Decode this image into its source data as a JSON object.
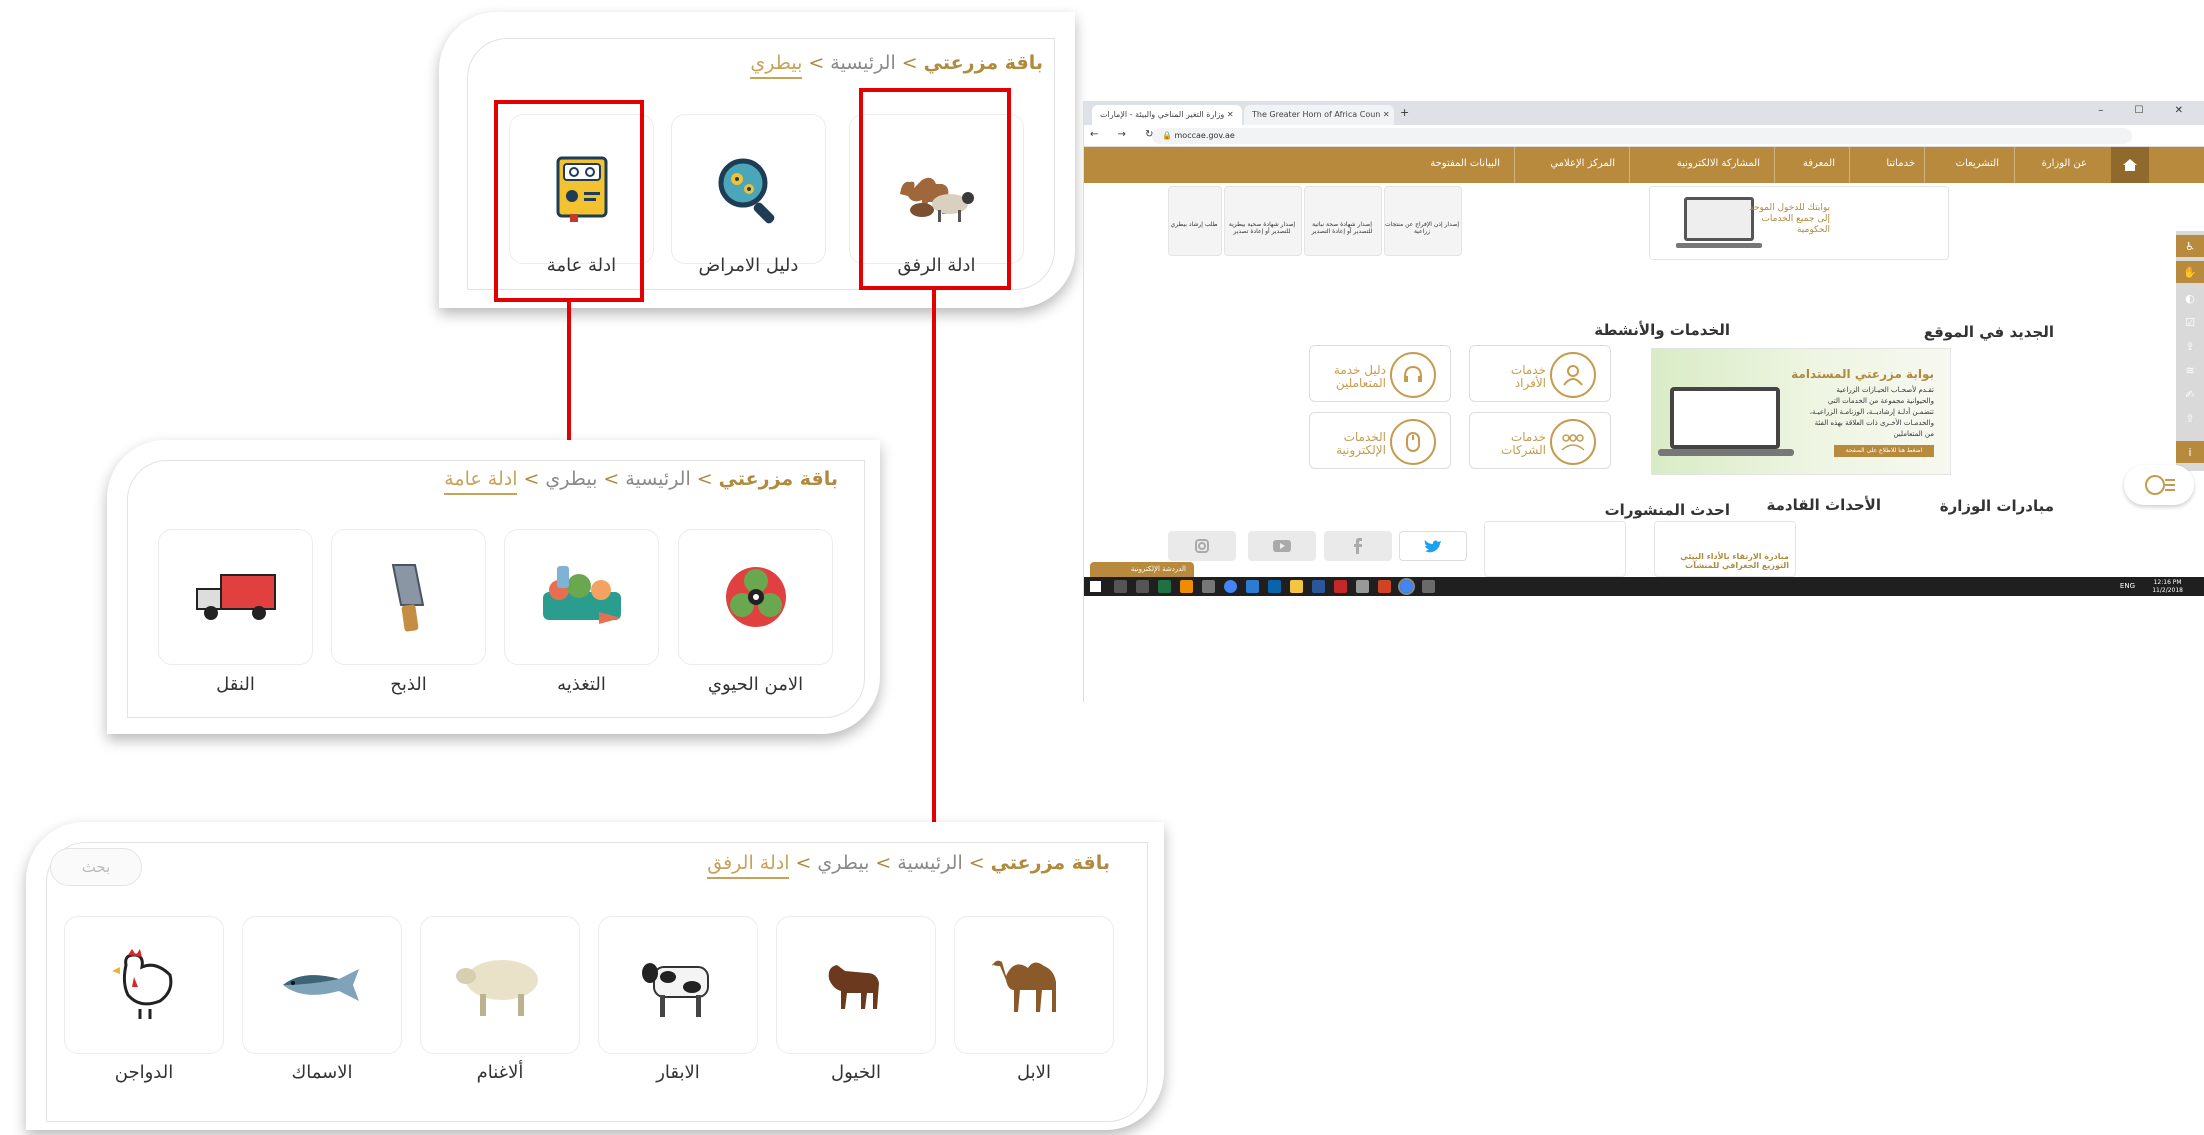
{
  "zoom_top": {
    "breadcrumb": {
      "brand": "باقة مزرعتي",
      "sep1": ">",
      "home": "الرئيسية",
      "sep2": ">",
      "current": "بيطري"
    },
    "tiles": [
      {
        "label": "ادلة الرفق",
        "icon": "camel-sheep-icon",
        "highlighted": true
      },
      {
        "label": "دليل الامراض",
        "icon": "microscope-virus-icon",
        "highlighted": false
      },
      {
        "label": "ادلة عامة",
        "icon": "guide-book-icon",
        "highlighted": true
      }
    ]
  },
  "zoom_mid": {
    "breadcrumb": {
      "brand": "باقة مزرعتي",
      "sep1": ">",
      "home": "الرئيسية",
      "sep2": ">",
      "parent": "بيطري",
      "sep3": ">",
      "current": "ادلة عامة"
    },
    "tiles": [
      {
        "label": "الامن الحيوي",
        "icon": "biohazard-icon"
      },
      {
        "label": "التغذيه",
        "icon": "feed-icon"
      },
      {
        "label": "الذبح",
        "icon": "cleaver-icon"
      },
      {
        "label": "النقل",
        "icon": "truck-icon"
      }
    ]
  },
  "zoom_bot": {
    "breadcrumb": {
      "brand": "باقة مزرعتي",
      "sep1": ">",
      "home": "الرئيسية",
      "sep2": ">",
      "parent": "بيطري",
      "sep3": ">",
      "current": "ادلة الرفق"
    },
    "search_label": "بحث",
    "tiles": [
      {
        "label": "الابل",
        "icon": "camel-icon"
      },
      {
        "label": "الخيول",
        "icon": "horse-icon"
      },
      {
        "label": "الابقار",
        "icon": "cow-icon"
      },
      {
        "label": "ألاغنام",
        "icon": "sheep-icon"
      },
      {
        "label": "الاسماك",
        "icon": "fish-icon"
      },
      {
        "label": "الدواجن",
        "icon": "chicken-icon"
      }
    ]
  },
  "site": {
    "browser_tabs": [
      "وزارة التغير المناخي والبيئة - الإمارات",
      "The Greater Horn of Africa Coun"
    ],
    "url": "moccae.gov.ae",
    "nav": [
      "عن الوزارة",
      "التشريعات",
      "خدماتنا",
      "المعرفة",
      "المشاركة الالكترونية",
      "المركز الإعلامي",
      "البيانات المفتوحة"
    ],
    "carousel_portal": [
      "بوابتك للدخول الموحد",
      "إلى جميع الخدمات",
      "الحكومية"
    ],
    "carousel_items": [
      "إصدار إذن الإفراج عن منتجات زراعية",
      "إصدار شهادة صحة نباتية للتصدير أو إعادة التصدير",
      "إصدار شهادة صحية بيطرية للتصدير أو إعادة تصدير",
      "طلب إرشاد بيطري"
    ],
    "new_title": "الجديد في الموقع",
    "services_title": "الخدمات والأنشطة",
    "banner_title": "بوابة مزرعتي المستدامة",
    "banner_text": "تقـدم لأصحـاب الحيـازات الزراعية والحيوانية مجموعة من الخدمات التي تتضمـن أدلـة إرشاديــة، الوزنامـة الزراعيـة، والخدمـات الأخـرى ذات العلاقة بهذه الفئة من المتعاملين",
    "banner_button": "اضغط هنا للاطلاع على الصفحة",
    "services": [
      {
        "label1": "خدمات",
        "label2": "الأفراد",
        "icon": "person-icon"
      },
      {
        "label1": "دليل خدمة",
        "label2": "المتعاملين",
        "icon": "headset-icon"
      },
      {
        "label1": "خدمات",
        "label2": "الشركات",
        "icon": "group-icon"
      },
      {
        "label1": "الخدمات",
        "label2": "الإلكترونية",
        "icon": "mouse-icon"
      }
    ],
    "initiatives_title": "مبادرات الوزارة",
    "events_title": "الأحداث القادمة",
    "posts_title": "احدث المنشورات",
    "initiative_text": "مبادرة الارتقاء بالأداء البيئي التوزيع الجغرافي للمنشآت",
    "chat_label": "الدردشة الإلكترونية",
    "clock_time": "12:16 PM",
    "clock_date": "11/2/2018",
    "lang": "ENG"
  }
}
